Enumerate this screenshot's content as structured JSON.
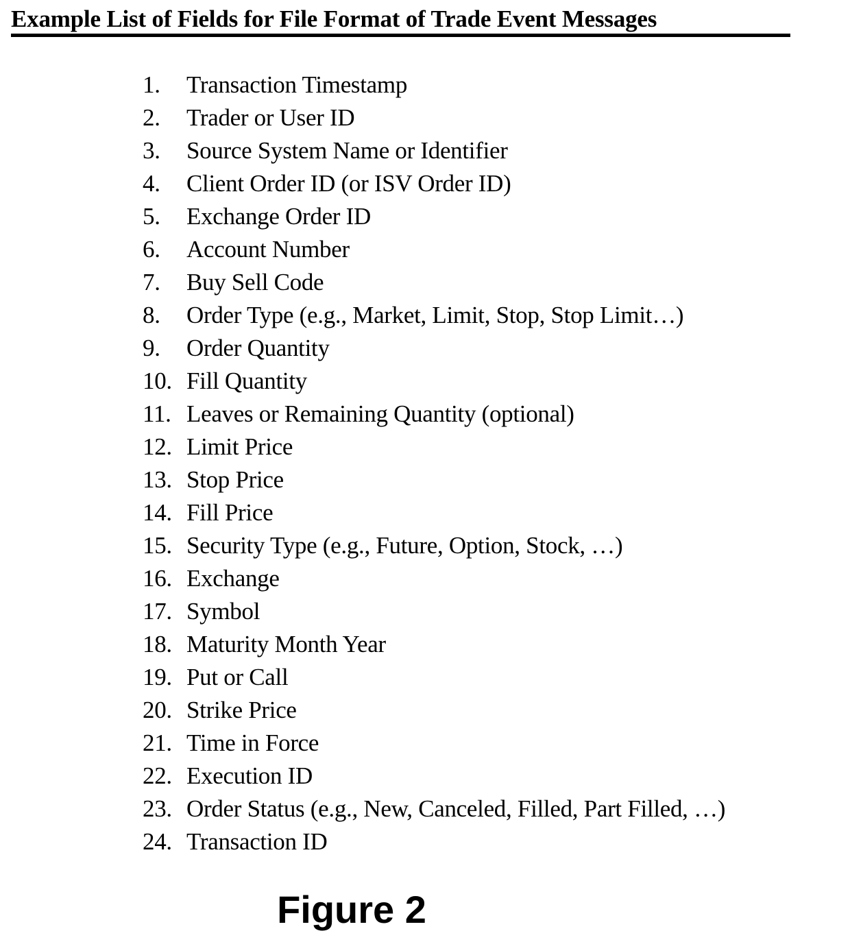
{
  "document": {
    "title": "Example List of Fields for File Format of Trade Event Messages",
    "caption": "Figure 2",
    "background_color": "#ffffff",
    "text_color": "#000000"
  },
  "list": {
    "items": [
      {
        "number": "1.",
        "label": "Transaction Timestamp"
      },
      {
        "number": "2.",
        "label": "Trader or User ID"
      },
      {
        "number": "3.",
        "label": "Source System Name or Identifier"
      },
      {
        "number": "4.",
        "label": "Client Order ID (or ISV Order ID)"
      },
      {
        "number": "5.",
        "label": "Exchange Order ID"
      },
      {
        "number": "6.",
        "label": "Account Number"
      },
      {
        "number": "7.",
        "label": "Buy Sell Code"
      },
      {
        "number": "8.",
        "label": "Order Type (e.g., Market, Limit, Stop, Stop Limit…)"
      },
      {
        "number": "9.",
        "label": "Order Quantity"
      },
      {
        "number": "10.",
        "label": "Fill Quantity"
      },
      {
        "number": "11.",
        "label": "Leaves or Remaining Quantity (optional)"
      },
      {
        "number": "12.",
        "label": "Limit Price"
      },
      {
        "number": "13.",
        "label": "Stop Price"
      },
      {
        "number": "14.",
        "label": "Fill Price"
      },
      {
        "number": "15.",
        "label": "Security Type (e.g., Future, Option, Stock, …)"
      },
      {
        "number": "16.",
        "label": "Exchange"
      },
      {
        "number": "17.",
        "label": "Symbol"
      },
      {
        "number": "18.",
        "label": "Maturity Month Year"
      },
      {
        "number": "19.",
        "label": "Put or Call"
      },
      {
        "number": "20.",
        "label": "Strike Price"
      },
      {
        "number": "21.",
        "label": "Time in Force"
      },
      {
        "number": "22.",
        "label": "Execution ID"
      },
      {
        "number": "23.",
        "label": "Order Status (e.g., New, Canceled, Filled, Part Filled, …)"
      },
      {
        "number": "24.",
        "label": "Transaction ID"
      }
    ]
  }
}
